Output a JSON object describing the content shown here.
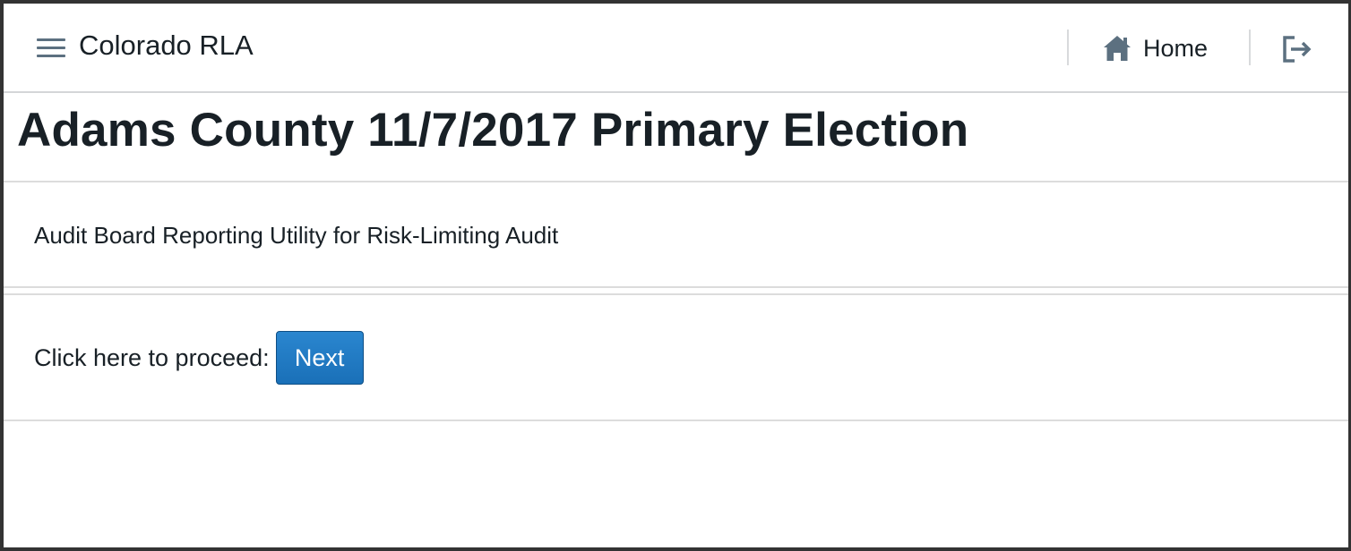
{
  "navbar": {
    "menu_icon": "hamburger-menu-icon",
    "app_title": "Colorado RLA",
    "home_label": "Home",
    "home_icon": "home-icon",
    "logout_icon": "logout-icon"
  },
  "main": {
    "title": "Adams County 11/7/2017 Primary Election",
    "subtitle": "Audit Board Reporting Utility for Risk-Limiting Audit",
    "proceed_label": "Click here to proceed:",
    "next_label": "Next"
  },
  "colors": {
    "primary_button": "#1f7bc4",
    "icon": "#5c7080",
    "text": "#182026"
  }
}
